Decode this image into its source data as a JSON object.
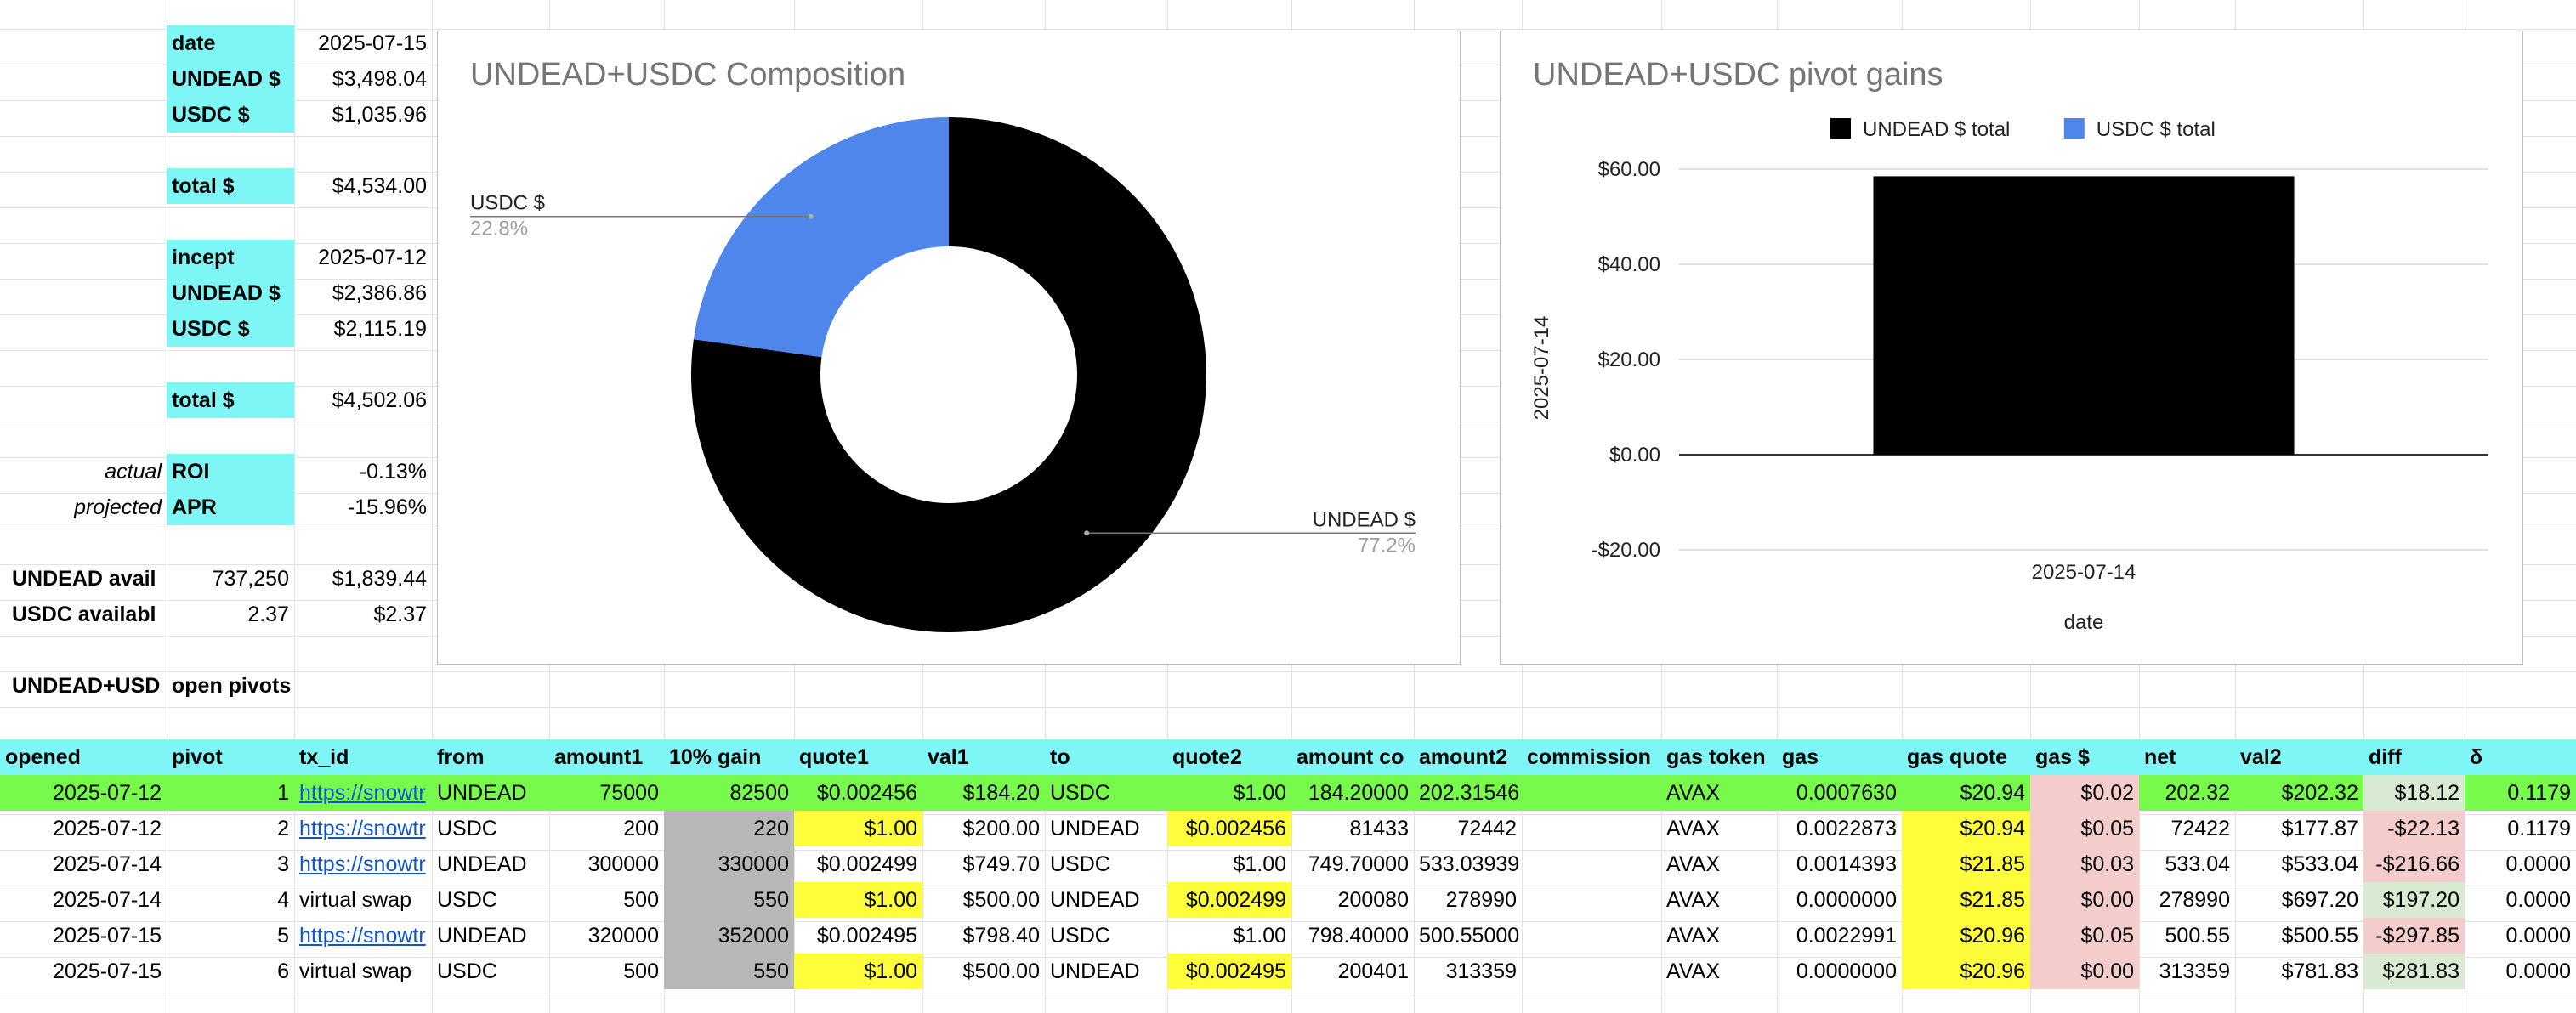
{
  "summary": {
    "current": {
      "date_label": "date",
      "date_value": "2025-07-15",
      "undead_label": "UNDEAD $",
      "undead_value": "$3,498.04",
      "usdc_label": "USDC $",
      "usdc_value": "$1,035.96",
      "total_label": "total $",
      "total_value": "$4,534.00"
    },
    "incept": {
      "label": "incept",
      "date_value": "2025-07-12",
      "undead_label": "UNDEAD $",
      "undead_value": "$2,386.86",
      "usdc_label": "USDC $",
      "usdc_value": "$2,115.19",
      "total_label": "total $",
      "total_value": "$4,502.06"
    },
    "roi": {
      "prefix": "actual",
      "label": "ROI",
      "value": "-0.13%"
    },
    "apr": {
      "prefix": "projected",
      "label": "APR",
      "value": "-15.96%"
    },
    "undead_avail": {
      "label": "UNDEAD avail",
      "qty": "737,250",
      "usd": "$1,839.44"
    },
    "usdc_avail": {
      "label": "USDC availabl",
      "qty": "2.37",
      "usd": "$2.37"
    }
  },
  "open_pivots_title": "UNDEAD+USD",
  "open_pivots_title2": "open pivots",
  "colors": {
    "cyan": "#7ff6f6",
    "green_row": "#77fa4c",
    "yellow": "#fdfd3c",
    "gray": "#b7b7b7",
    "pink": "#f4cccc",
    "light_green": "#d9ead3",
    "undead_series": "#000000",
    "usdc_series": "#4f86ec"
  },
  "chart_data": [
    {
      "type": "pie",
      "title": "UNDEAD+USDC Composition",
      "donut": true,
      "slices": [
        {
          "name": "UNDEAD $",
          "pct_label": "77.2%",
          "value": 77.2,
          "color": "#000000"
        },
        {
          "name": "USDC $",
          "pct_label": "22.8%",
          "value": 22.8,
          "color": "#4f86ec"
        }
      ]
    },
    {
      "type": "bar",
      "title": "UNDEAD+USDC pivot gains",
      "categories": [
        "2025-07-14"
      ],
      "series": [
        {
          "name": "UNDEAD $ total",
          "values": [
            58.5
          ],
          "color": "#000000"
        },
        {
          "name": "USDC $ total",
          "values": [
            0
          ],
          "color": "#4f86ec"
        }
      ],
      "xlabel": "date",
      "ylabel": "2025-07-14",
      "ylim": [
        -20,
        60
      ],
      "yticks": [
        "-$20.00",
        "$0.00",
        "$20.00",
        "$40.00",
        "$60.00"
      ],
      "legend": "top",
      "grid": true
    }
  ],
  "table": {
    "headers": [
      "opened",
      "pivot",
      "tx_id",
      "from",
      "amount1",
      "10% gain",
      "quote1",
      "val1",
      "to",
      "quote2",
      "amount co",
      "amount2",
      "commission",
      "gas token",
      "gas",
      "gas quote",
      "gas $",
      "net",
      "val2",
      "diff",
      "δ"
    ],
    "rows": [
      [
        "2025-07-12",
        "1",
        "https://snowtr",
        "UNDEAD",
        "75000",
        "82500",
        "$0.002456",
        "$184.20",
        "USDC",
        "$1.00",
        "184.20000",
        "202.31546",
        "",
        "AVAX",
        "0.0007630",
        "$20.94",
        "$0.02",
        "202.32",
        "$202.32",
        "$18.12",
        "0.1179"
      ],
      [
        "2025-07-12",
        "2",
        "https://snowtr",
        "USDC",
        "200",
        "220",
        "$1.00",
        "$200.00",
        "UNDEAD",
        "$0.002456",
        "81433",
        "72442",
        "",
        "AVAX",
        "0.0022873",
        "$20.94",
        "$0.05",
        "72422",
        "$177.87",
        "-$22.13",
        "0.1179"
      ],
      [
        "2025-07-14",
        "3",
        "https://snowtr",
        "UNDEAD",
        "300000",
        "330000",
        "$0.002499",
        "$749.70",
        "USDC",
        "$1.00",
        "749.70000",
        "533.03939",
        "",
        "AVAX",
        "0.0014393",
        "$21.85",
        "$0.03",
        "533.04",
        "$533.04",
        "-$216.66",
        "0.0000"
      ],
      [
        "2025-07-14",
        "4",
        "virtual swap",
        "USDC",
        "500",
        "550",
        "$1.00",
        "$500.00",
        "UNDEAD",
        "$0.002499",
        "200080",
        "278990",
        "",
        "AVAX",
        "0.0000000",
        "$21.85",
        "$0.00",
        "278990",
        "$697.20",
        "$197.20",
        "0.0000"
      ],
      [
        "2025-07-15",
        "5",
        "https://snowtr",
        "UNDEAD",
        "320000",
        "352000",
        "$0.002495",
        "$798.40",
        "USDC",
        "$1.00",
        "798.40000",
        "500.55000",
        "",
        "AVAX",
        "0.0022991",
        "$20.96",
        "$0.05",
        "500.55",
        "$500.55",
        "-$297.85",
        "0.0000"
      ],
      [
        "2025-07-15",
        "6",
        "virtual swap",
        "USDC",
        "500",
        "550",
        "$1.00",
        "$500.00",
        "UNDEAD",
        "$0.002495",
        "200401",
        "313359",
        "",
        "AVAX",
        "0.0000000",
        "$20.96",
        "$0.00",
        "313359",
        "$781.83",
        "$281.83",
        "0.0000"
      ]
    ]
  }
}
